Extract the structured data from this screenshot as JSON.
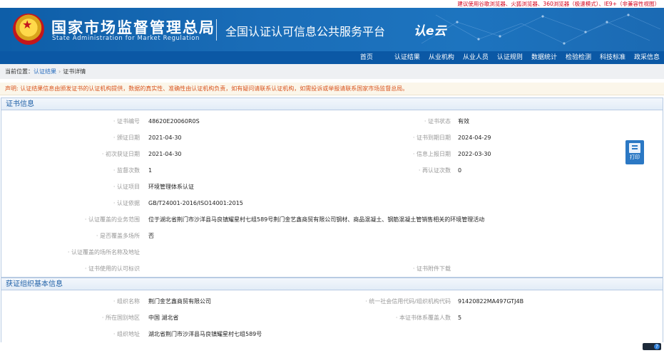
{
  "top_note": "建议使用谷歌浏览器、火狐浏览器、360浏览器（极速模式）、IE9+（非兼容性视图）",
  "header": {
    "org_name_cn": "国家市场监督管理总局",
    "org_name_en": "State Administration  for  Market Regulation",
    "platform_title": "全国认证认可信息公共服务平台",
    "platform_logo": "认e云"
  },
  "nav": [
    "首页",
    "认证结果",
    "从业机构",
    "从业人员",
    "认证规则",
    "数据统计",
    "检验检测",
    "科技标准",
    "政采信息"
  ],
  "breadcrumb": {
    "prefix": "当前位置：",
    "item1": "认证结果",
    "sep": "›",
    "item2": "证书详情"
  },
  "notice": "声明: 认证结果信息由颁发证书的认证机构提供，数据的真实性、准确性由认证机构负责，如有疑问请联系认证机构，如需投诉或举报请联系国家市场监督总局。",
  "cert_section": {
    "title": "证书信息",
    "print_label": "打印",
    "rows": [
      {
        "l1": "· 证书编号",
        "v1": "48620E20060R0S",
        "l2": "· 证书状态",
        "v2": "有效"
      },
      {
        "l1": "· 颁证日期",
        "v1": "2021-04-30",
        "l2": "· 证书到期日期",
        "v2": "2024-04-29"
      },
      {
        "l1": "· 初次获证日期",
        "v1": "2021-04-30",
        "l2": "· 信息上报日期",
        "v2": "2022-03-30"
      },
      {
        "l1": "· 监督次数",
        "v1": "1",
        "l2": "· 再认证次数",
        "v2": "0"
      },
      {
        "l1": "· 认证项目",
        "v1": "环境管理体系认证",
        "l2": "",
        "v2": ""
      },
      {
        "l1": "· 认证依据",
        "v1": "GB/T24001-2016/ISO14001:2015",
        "l2": "",
        "v2": ""
      },
      {
        "l1": "· 认证覆盖的业务范围",
        "v1": "位于湖北省荆门市沙洋县马良镇耀星村七组589号荆门金艺鑫商贸有限公司钢材、商品混凝土、钢筋混凝土管销售相关的环境管理活动",
        "l2": "",
        "v2": ""
      },
      {
        "l1": "· 是否覆盖多场所",
        "v1": "否",
        "l2": "",
        "v2": ""
      },
      {
        "l1": "· 认证覆盖的场所名称及地址",
        "v1": "",
        "l2": "",
        "v2": ""
      },
      {
        "l1": "· 证书使用的认可标识",
        "v1": "",
        "l2": "· 证书附件下载",
        "v2": ""
      }
    ]
  },
  "org_section": {
    "title": "获证组织基本信息",
    "rows": [
      {
        "l1": "· 组织名称",
        "v1": "荆门金艺鑫商贸有限公司",
        "l2": "· 统一社会信用代码/组织机构代码",
        "v2": "91420822MA497GTJ4B"
      },
      {
        "l1": "· 所在国别地区",
        "v1": "中国 湖北省",
        "l2": "· 本证书体系覆盖人数",
        "v2": "5"
      },
      {
        "l1": "· 组织地址",
        "v1": "湖北省荆门市沙洋县马良镇耀星村七组589号",
        "l2": "",
        "v2": ""
      }
    ]
  },
  "colors": {
    "banner": "#1a6db8",
    "nav": "#0b58a5",
    "notice_text": "#d9541e",
    "top_note": "#d4001a",
    "section_title": "#1d5fa6"
  }
}
